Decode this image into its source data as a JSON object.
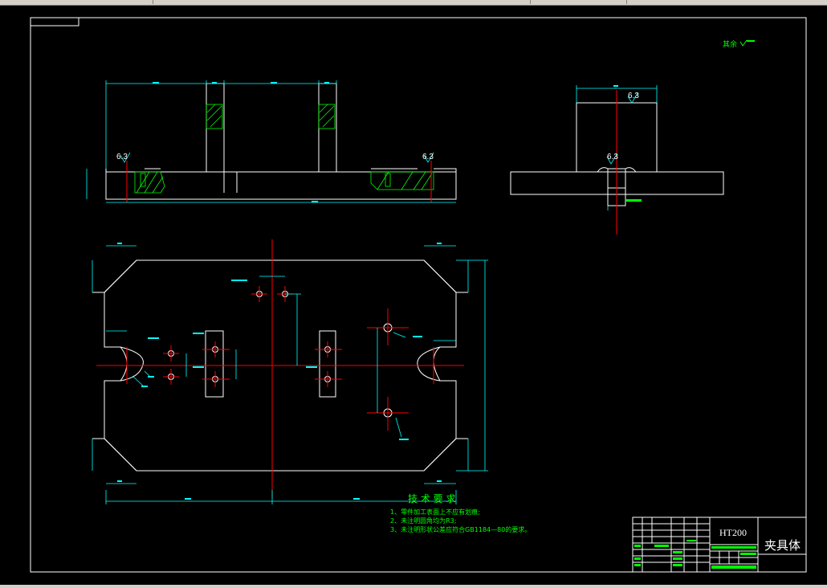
{
  "surface_finish_note": "其余",
  "roughness": {
    "top_left": "6.3",
    "top_right": "6.3",
    "side_top": "6.3",
    "side_mid": "6.3"
  },
  "tech_requirements": {
    "title": "技 术 要 求",
    "items": [
      "1、零件加工表面上不应有划痕;",
      "2、未注明圆角均为R3;",
      "3、未注明形状公差应符合GB1184—80的要求。"
    ]
  },
  "title_block": {
    "material": "HT200",
    "part_name": "夹具体"
  },
  "colors": {
    "outline": "#ffffff",
    "dimension": "#00ffff",
    "centerline": "#ff0000",
    "hatch": "#00ff00",
    "note": "#00ff00",
    "frame": "#ffffff"
  }
}
